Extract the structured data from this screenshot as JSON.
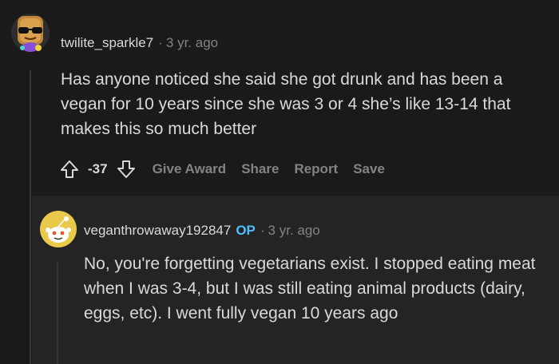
{
  "comment": {
    "avatar_icon": "sunglasses-avatar-icon",
    "username": "twilite_sparkle7",
    "separator": "·",
    "timestamp": "3 yr. ago",
    "body": "Has anyone noticed she said she got drunk and has been a vegan for 10 years since she was 3 or 4 she’s like 13-14 that makes this so much better",
    "score": "-37",
    "actions": {
      "upvote_icon": "upvote-arrow-icon",
      "downvote_icon": "downvote-arrow-icon",
      "give_award": "Give Award",
      "share": "Share",
      "report": "Report",
      "save": "Save"
    }
  },
  "reply": {
    "avatar_icon": "snoo-avatar-icon",
    "username": "veganthrowaway192847",
    "op_badge": "OP",
    "separator": "·",
    "timestamp": "3 yr. ago",
    "body": "No, you're forgetting vegetarians exist. I stopped eating meat when I was 3-4, but I was still eating animal products (dairy, eggs, etc). I went fully vegan 10 years ago"
  },
  "colors": {
    "background": "#1a1a1b",
    "reply_background": "#242425",
    "text": "#d7dadc",
    "muted": "#818384",
    "op_accent": "#4fbcff"
  }
}
